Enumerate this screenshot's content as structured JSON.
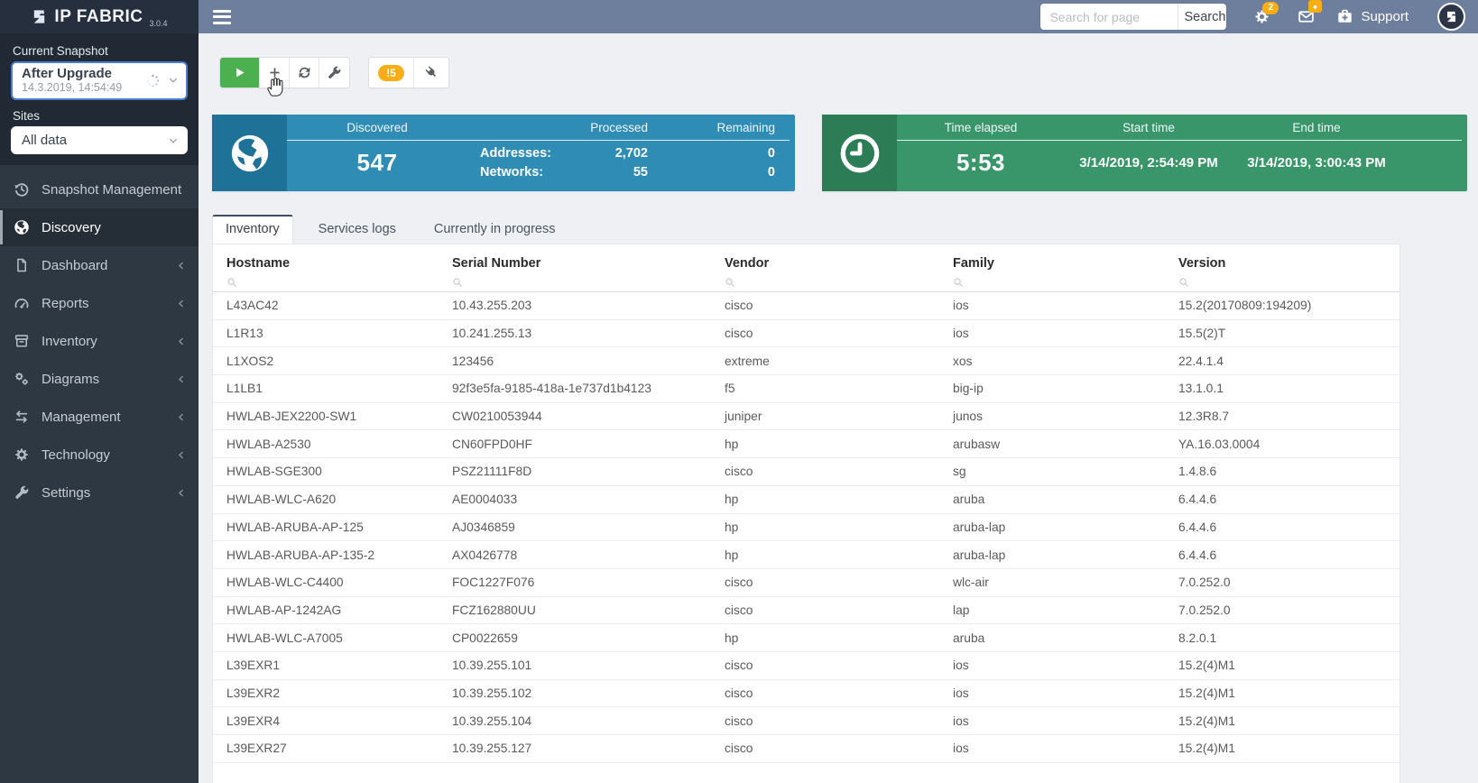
{
  "app": {
    "brand": "IP FABRIC",
    "version": "3.0.4"
  },
  "topbar": {
    "search_placeholder": "Search for page",
    "search_button": "Search",
    "settings_badge": "2",
    "support_label": "Support"
  },
  "sidebar": {
    "current_snapshot_label": "Current Snapshot",
    "snapshot_name": "After Upgrade",
    "snapshot_date": "14.3.2019, 14:54:49",
    "sites_label": "Sites",
    "sites_value": "All data",
    "items": [
      {
        "label": "Snapshot Management",
        "icon": "history-icon",
        "expandable": false,
        "active": false
      },
      {
        "label": "Discovery",
        "icon": "globe-icon",
        "expandable": false,
        "active": true
      },
      {
        "label": "Dashboard",
        "icon": "document-icon",
        "expandable": true,
        "active": false
      },
      {
        "label": "Reports",
        "icon": "gauge-icon",
        "expandable": true,
        "active": false
      },
      {
        "label": "Inventory",
        "icon": "archive-icon",
        "expandable": true,
        "active": false
      },
      {
        "label": "Diagrams",
        "icon": "gears-icon",
        "expandable": true,
        "active": false
      },
      {
        "label": "Management",
        "icon": "swap-icon",
        "expandable": true,
        "active": false
      },
      {
        "label": "Technology",
        "icon": "gear-icon",
        "expandable": true,
        "active": false
      },
      {
        "label": "Settings",
        "icon": "wrench-icon",
        "expandable": true,
        "active": false
      }
    ]
  },
  "toolbar": {
    "alert_badge": "!5"
  },
  "discovery_card": {
    "headers": [
      "Discovered",
      "Processed",
      "Remaining"
    ],
    "discovered_value": "547",
    "stats": [
      {
        "label": "Addresses:",
        "processed": "2,702",
        "remaining": "0"
      },
      {
        "label": "Networks:",
        "processed": "55",
        "remaining": "0"
      }
    ]
  },
  "time_card": {
    "headers": [
      "Time elapsed",
      "Start time",
      "End time"
    ],
    "elapsed": "5:53",
    "start_time": "3/14/2019, 2:54:49 PM",
    "end_time": "3/14/2019, 3:00:43 PM"
  },
  "tabs": [
    {
      "label": "Inventory",
      "active": true
    },
    {
      "label": "Services logs",
      "active": false
    },
    {
      "label": "Currently in progress",
      "active": false
    }
  ],
  "inventory_table": {
    "columns": [
      "Hostname",
      "Serial Number",
      "Vendor",
      "Family",
      "Version"
    ],
    "rows": [
      [
        "L43AC42",
        "10.43.255.203",
        "cisco",
        "ios",
        "15.2(20170809:194209)"
      ],
      [
        "L1R13",
        "10.241.255.13",
        "cisco",
        "ios",
        "15.5(2)T"
      ],
      [
        "L1XOS2",
        "123456",
        "extreme",
        "xos",
        "22.4.1.4"
      ],
      [
        "L1LB1",
        "92f3e5fa-9185-418a-1e737d1b4123",
        "f5",
        "big-ip",
        "13.1.0.1"
      ],
      [
        "HWLAB-JEX2200-SW1",
        "CW0210053944",
        "juniper",
        "junos",
        "12.3R8.7"
      ],
      [
        "HWLAB-A2530",
        "CN60FPD0HF",
        "hp",
        "arubasw",
        "YA.16.03.0004"
      ],
      [
        "HWLAB-SGE300",
        "PSZ21111F8D",
        "cisco",
        "sg",
        "1.4.8.6"
      ],
      [
        "HWLAB-WLC-A620",
        "AE0004033",
        "hp",
        "aruba",
        "6.4.4.6"
      ],
      [
        "HWLAB-ARUBA-AP-125",
        "AJ0346859",
        "hp",
        "aruba-lap",
        "6.4.4.6"
      ],
      [
        "HWLAB-ARUBA-AP-135-2",
        "AX0426778",
        "hp",
        "aruba-lap",
        "6.4.4.6"
      ],
      [
        "HWLAB-WLC-C4400",
        "FOC1227F076",
        "cisco",
        "wlc-air",
        "7.0.252.0"
      ],
      [
        "HWLAB-AP-1242AG",
        "FCZ162880UU",
        "cisco",
        "lap",
        "7.0.252.0"
      ],
      [
        "HWLAB-WLC-A7005",
        "CP0022659",
        "hp",
        "aruba",
        "8.2.0.1"
      ],
      [
        "L39EXR1",
        "10.39.255.101",
        "cisco",
        "ios",
        "15.2(4)M1"
      ],
      [
        "L39EXR2",
        "10.39.255.102",
        "cisco",
        "ios",
        "15.2(4)M1"
      ],
      [
        "L39EXR4",
        "10.39.255.104",
        "cisco",
        "ios",
        "15.2(4)M1"
      ],
      [
        "L39EXR27",
        "10.39.255.127",
        "cisco",
        "ios",
        "15.2(4)M1"
      ]
    ]
  },
  "colors": {
    "topbar": "#6e7f9e",
    "sidebar": "#2e3843",
    "card_blue": "#2f8cb4",
    "card_blue_dark": "#1e7298",
    "card_green": "#39966a",
    "card_green_dark": "#2c7d55",
    "play_green": "#4caf50",
    "warning_orange": "#faad14",
    "snapshot_border_blue": "#4b7fd6"
  }
}
